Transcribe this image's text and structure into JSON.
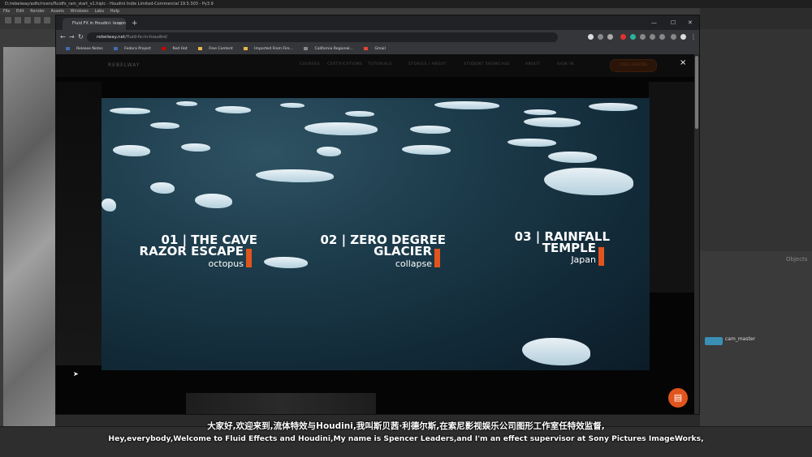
{
  "houdini": {
    "window_title": "D:/rebelway/adfx/rivers/fluidfx_rain_start_v1.hiplc - Houdini Indie Limited-Commercial 19.5.303 - Py3.9",
    "menu": [
      "File",
      "Edit",
      "Render",
      "Assets",
      "Windows",
      "Labs",
      "Help"
    ],
    "network_node_label": "cam_master",
    "network_context_label": "Objects"
  },
  "browser": {
    "tab_title": "Fluid FX in Houdini: lessons from",
    "url_domain": "rebelway.net",
    "url_path": "/fluid-fx-in-houdini/",
    "bookmarks": [
      "Release Notes",
      "Fedora Project",
      "Red Hat",
      "Free Content",
      "Imported From Fire...",
      "California Regional...",
      "Gmail"
    ]
  },
  "site": {
    "logo": "REBELWAY",
    "nav": [
      "COURSES",
      "CERTIFICATIONS",
      "TUTORIALS",
      "STORIES / ABOUT",
      "STUDENT SHOWCASE",
      "ABOUT",
      "SIGN IN"
    ],
    "cta": "FREE LESSONS",
    "close_glyph": "×",
    "projects": [
      {
        "line1": "01 | THE CAVE",
        "line2": "RAZOR ESCAPE",
        "sub": "octopus"
      },
      {
        "line1": "02 | ZERO DEGREE",
        "line2": "GLACIER",
        "sub": "collapse"
      },
      {
        "line1": "03 | RAINFALL",
        "line2": "TEMPLE",
        "sub": "Japan"
      }
    ],
    "accent_color": "#e0551d"
  },
  "subtitles": {
    "zh": "大家好,欢迎来到,流体特效与Houdini,我叫斯贝茜·利德尔斯,在索尼影视娱乐公司图形工作室任特效监督,",
    "en": "Hey,everybody,Welcome to Fluid Effects and Houdini,My name is Spencer Leaders,and I'm an effect supervisor at Sony Pictures ImageWorks,"
  }
}
